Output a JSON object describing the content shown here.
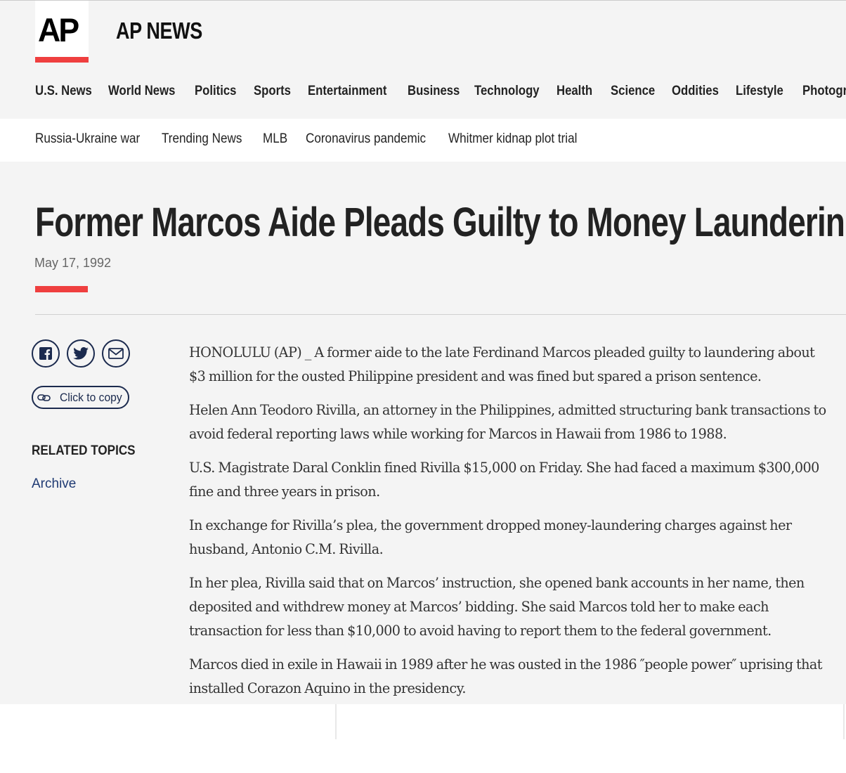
{
  "header": {
    "logo": "AP",
    "brand": "AP NEWS",
    "nav": [
      {
        "label": "U.S. News"
      },
      {
        "label": "World News"
      },
      {
        "label": "Politics"
      },
      {
        "label": "Sports"
      },
      {
        "label": "Entertainment"
      },
      {
        "label": "Business"
      },
      {
        "label": "Technology"
      },
      {
        "label": "Health"
      },
      {
        "label": "Science"
      },
      {
        "label": "Oddities"
      },
      {
        "label": "Lifestyle"
      },
      {
        "label": "Photography"
      }
    ]
  },
  "subnav": [
    {
      "label": "Russia-Ukraine war"
    },
    {
      "label": "Trending News"
    },
    {
      "label": "MLB"
    },
    {
      "label": "Coronavirus pandemic"
    },
    {
      "label": "Whitmer kidnap plot trial"
    }
  ],
  "article": {
    "headline": "Former Marcos Aide Pleads Guilty to Money Laundering",
    "date": "May 17, 1992",
    "paragraphs": [
      "HONOLULU (AP) _ A former aide to the late Ferdinand Marcos pleaded guilty to laundering about $3 million for the ousted Philippine president and was fined but spared a prison sentence.",
      "Helen Ann Teodoro Rivilla, an attorney in the Philippines, admitted structuring bank transactions to avoid federal reporting laws while working for Marcos in Hawaii from 1986 to 1988.",
      "U.S. Magistrate Daral Conklin fined Rivilla $15,000 on Friday. She had faced a maximum $300,000 fine and three years in prison.",
      "In exchange for Rivilla’s plea, the government dropped money-laundering charges against her husband, Antonio C.M. Rivilla.",
      "In her plea, Rivilla said that on Marcos’ instruction, she opened bank accounts in her name, then deposited and withdrew money at Marcos’ bidding. She said Marcos told her to make each transaction for less than $10,000 to avoid having to report them to the federal government.",
      "Marcos died in exile in Hawaii in 1989 after he was ousted in the 1986 ″people power″ uprising that installed Corazon Aquino in the presidency."
    ]
  },
  "sidebar": {
    "share_icons": [
      "facebook-icon",
      "twitter-icon",
      "email-icon"
    ],
    "copy_label": "Click to copy",
    "related_title": "RELATED TOPICS",
    "related_links": [
      {
        "label": "Archive"
      }
    ]
  },
  "colors": {
    "accent_red": "#ef3f3f",
    "navy": "#1b2a4e",
    "link": "#1f3a73"
  }
}
